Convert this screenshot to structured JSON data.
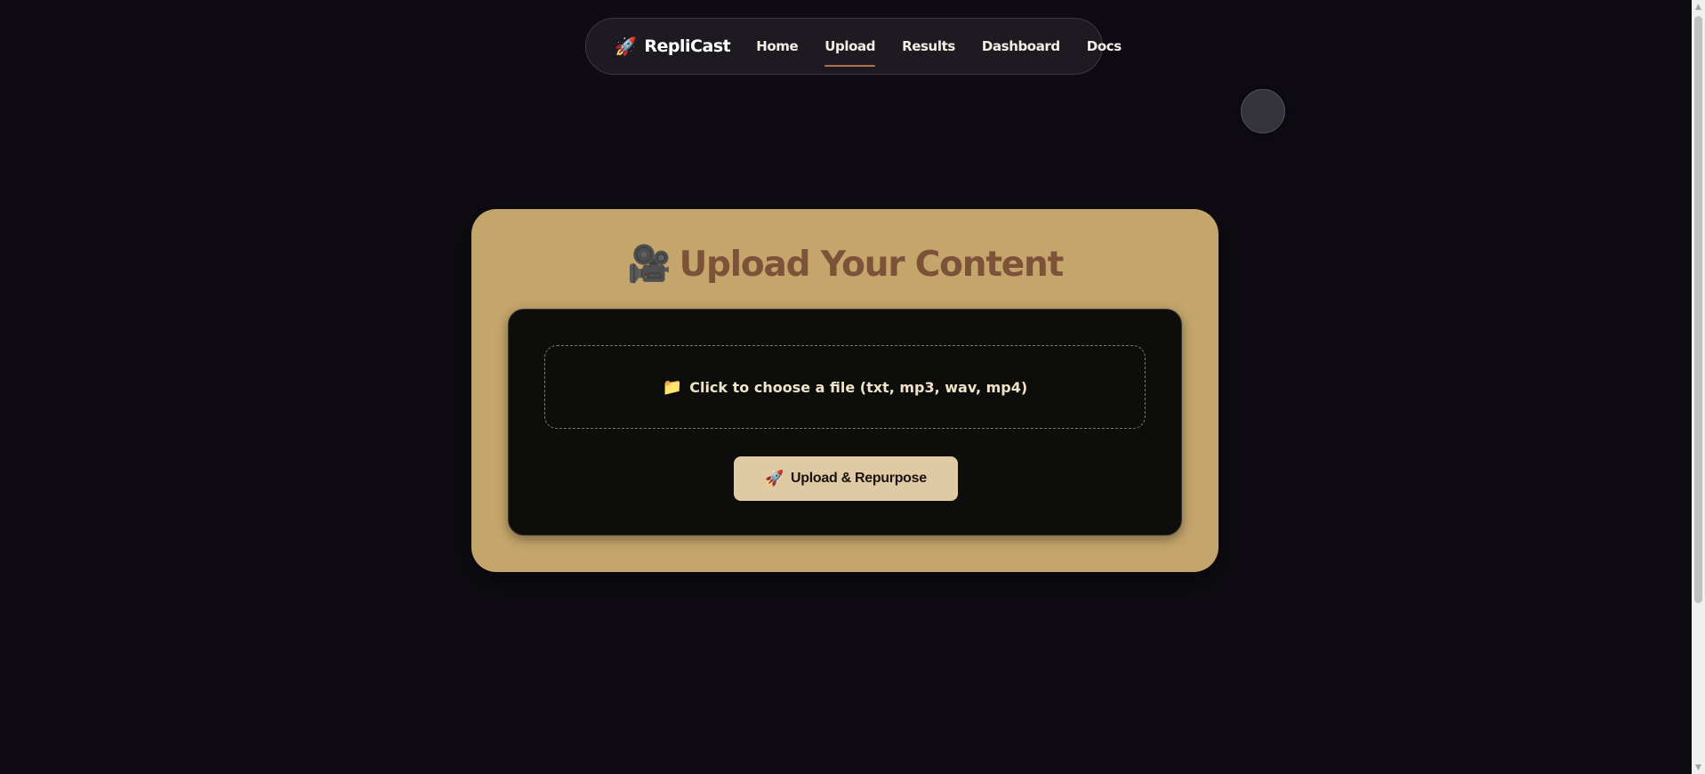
{
  "navbar": {
    "brand": {
      "icon": "rocket-icon",
      "icon_glyph": "🚀",
      "label": "RepliCast"
    },
    "links": [
      {
        "label": "Home",
        "active": false
      },
      {
        "label": "Upload",
        "active": true
      },
      {
        "label": "Results",
        "active": false
      },
      {
        "label": "Dashboard",
        "active": false
      },
      {
        "label": "Docs",
        "active": false
      }
    ]
  },
  "card": {
    "title_icon": "movie-camera-icon",
    "title_icon_glyph": "🎥",
    "title": "Upload Your Content",
    "dropzone": {
      "icon": "folder-icon",
      "icon_glyph": "📁",
      "label": "Click to choose a file (txt, mp3, wav, mp4)"
    },
    "upload_button": {
      "icon": "rocket-icon",
      "icon_glyph": "🚀",
      "label": "Upload & Repurpose"
    }
  },
  "colors": {
    "background": "#0e0c12",
    "card": "#c4a56b",
    "title": "#7c5238",
    "active_underline": "#b4714a",
    "button": "#dfcaa4"
  }
}
